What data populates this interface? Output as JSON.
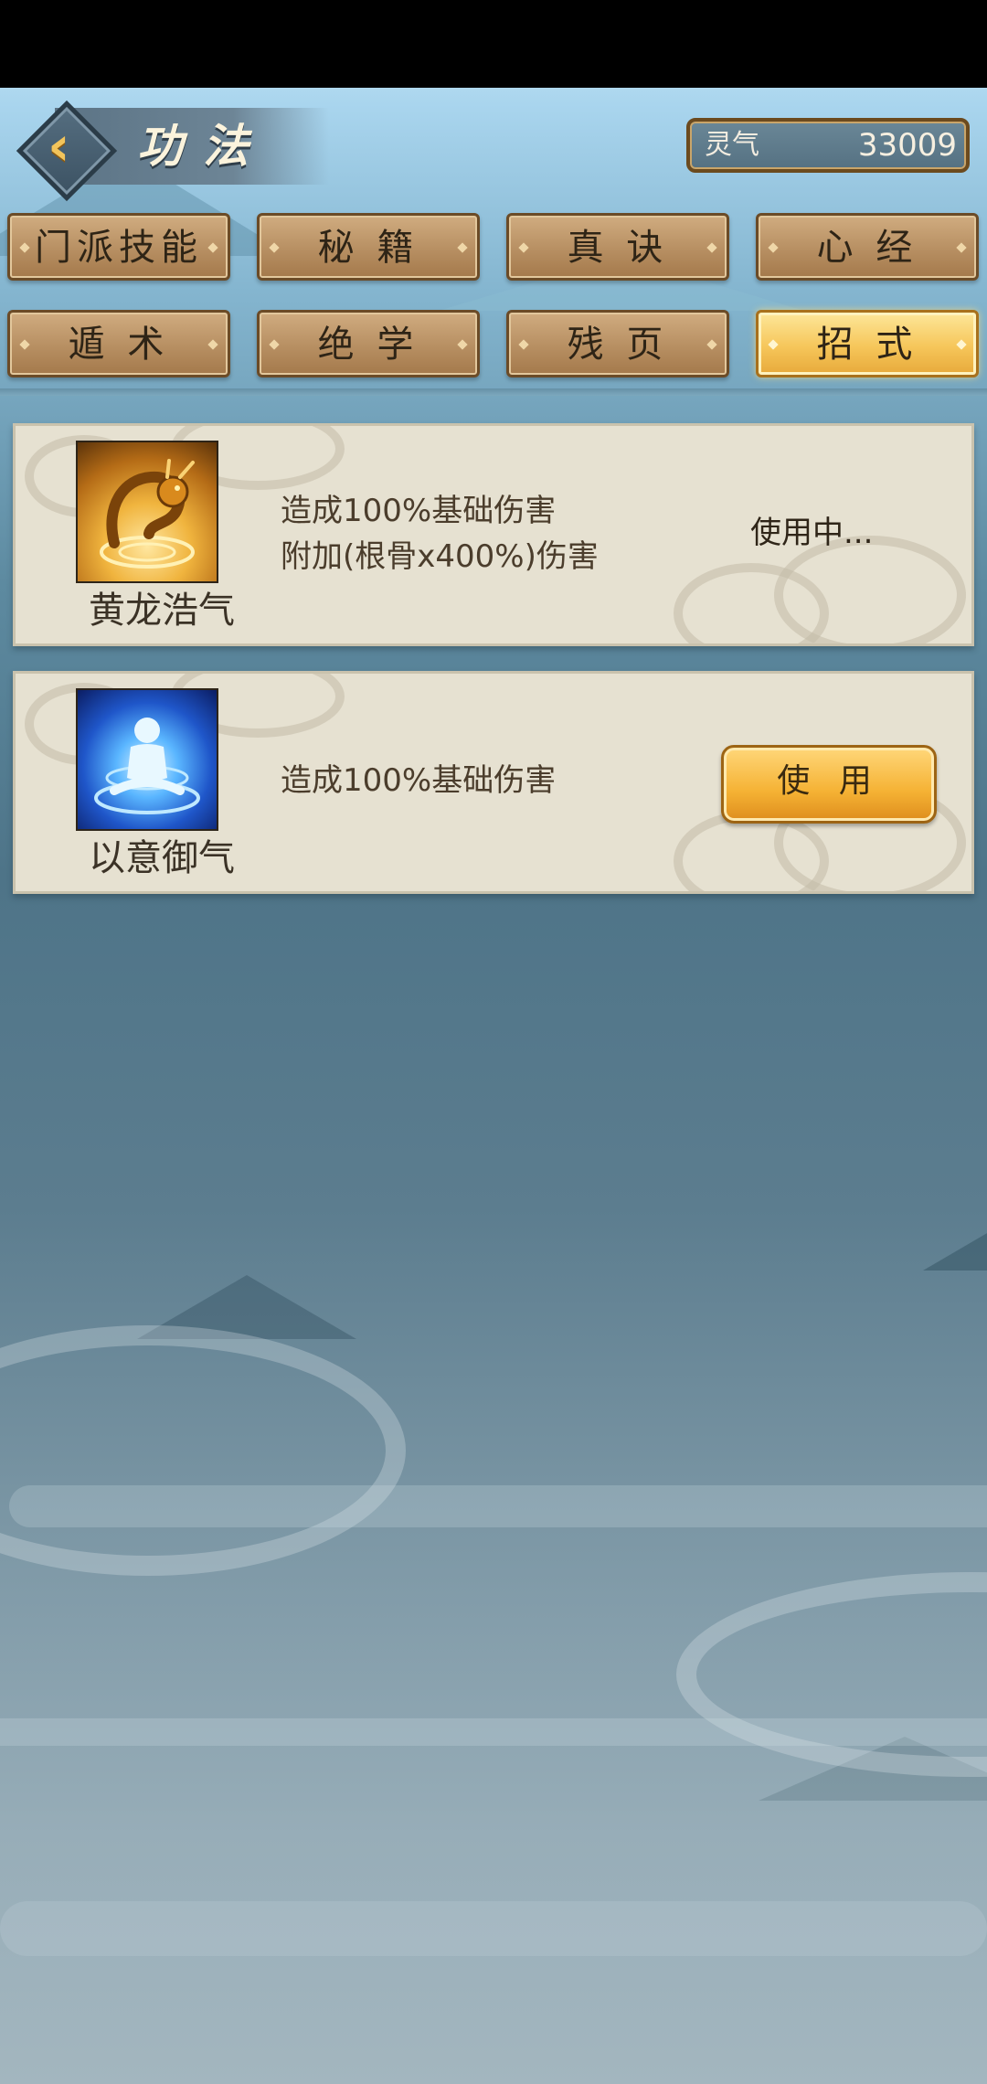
{
  "header": {
    "title": "功法",
    "currency": {
      "label": "灵气",
      "value": "33009"
    }
  },
  "tabs": [
    {
      "label": "门派技能",
      "active": false
    },
    {
      "label": "秘 籍",
      "active": false
    },
    {
      "label": "真 诀",
      "active": false
    },
    {
      "label": "心 经",
      "active": false
    },
    {
      "label": "遁 术",
      "active": false
    },
    {
      "label": "绝 学",
      "active": false
    },
    {
      "label": "残 页",
      "active": false
    },
    {
      "label": "招 式",
      "active": true
    }
  ],
  "skills": [
    {
      "name": "黄龙浩气",
      "icon": "golden-dragon-icon",
      "desc_lines": [
        "造成100%基础伤害",
        "附加(根骨x400%)伤害"
      ],
      "status": "使用中..."
    },
    {
      "name": "以意御气",
      "icon": "meditating-figure-icon",
      "desc_lines": [
        "造成100%基础伤害"
      ],
      "button_label": "使 用"
    }
  ],
  "colors": {
    "tab_brown": "#b78f62",
    "tab_active_gold": "#f6c65a",
    "card_bg": "#e6e1d1",
    "accent_gold": "#f2c45b"
  }
}
